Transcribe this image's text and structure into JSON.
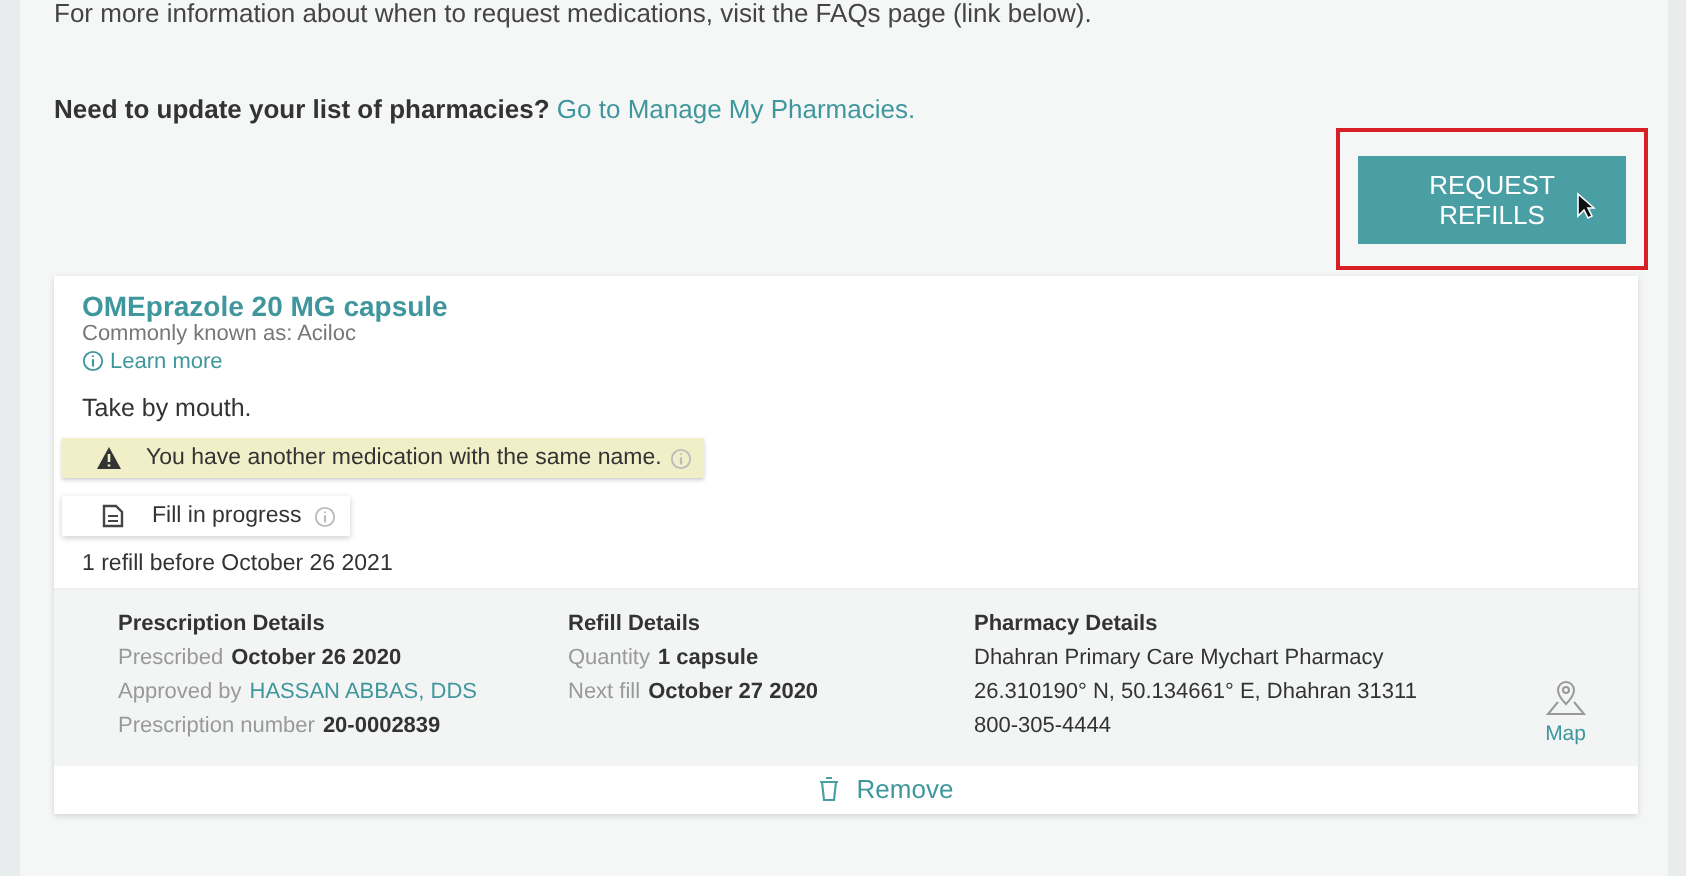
{
  "intro": "For more information about when to request medications, visit the FAQs page (link below).",
  "pharmacy_prompt": {
    "question": "Need to update your list of pharmacies?",
    "link": "Go to Manage My Pharmacies."
  },
  "request_button": {
    "label": "REQUEST REFILLS",
    "highlighted": true
  },
  "medication": {
    "name": "OMEprazole 20 MG capsule",
    "known_as": "Commonly known as: Aciloc",
    "learn_more": "Learn more",
    "instructions": "Take by mouth.",
    "warning": "You have another medication with the same name.",
    "status": "Fill in progress",
    "refills": "1 refill before October 26 2021",
    "details": [
      {
        "title": "Prescription Details",
        "lines": [
          {
            "label": "Prescribed",
            "value": "October 26 2020",
            "link": false
          },
          {
            "label": "Approved by",
            "value": "HASSAN ABBAS, DDS",
            "link": true
          },
          {
            "label": "Prescription number",
            "value": "20-0002839",
            "link": false
          }
        ]
      },
      {
        "title": "Refill Details",
        "lines": [
          {
            "label": "Quantity",
            "value": "1 capsule",
            "link": false
          },
          {
            "label": "Next fill",
            "value": "October 27 2020",
            "link": false
          }
        ]
      },
      {
        "title": "Pharmacy Details",
        "lines": [
          {
            "value": "Dhahran Primary Care Mychart Pharmacy",
            "link": false
          },
          {
            "value": "26.310190° N, 50.134661° E, Dhahran 31311",
            "link": false
          },
          {
            "value": "800-305-4444",
            "link": false
          }
        ]
      }
    ],
    "map_link": "Map",
    "remove": "Remove"
  }
}
